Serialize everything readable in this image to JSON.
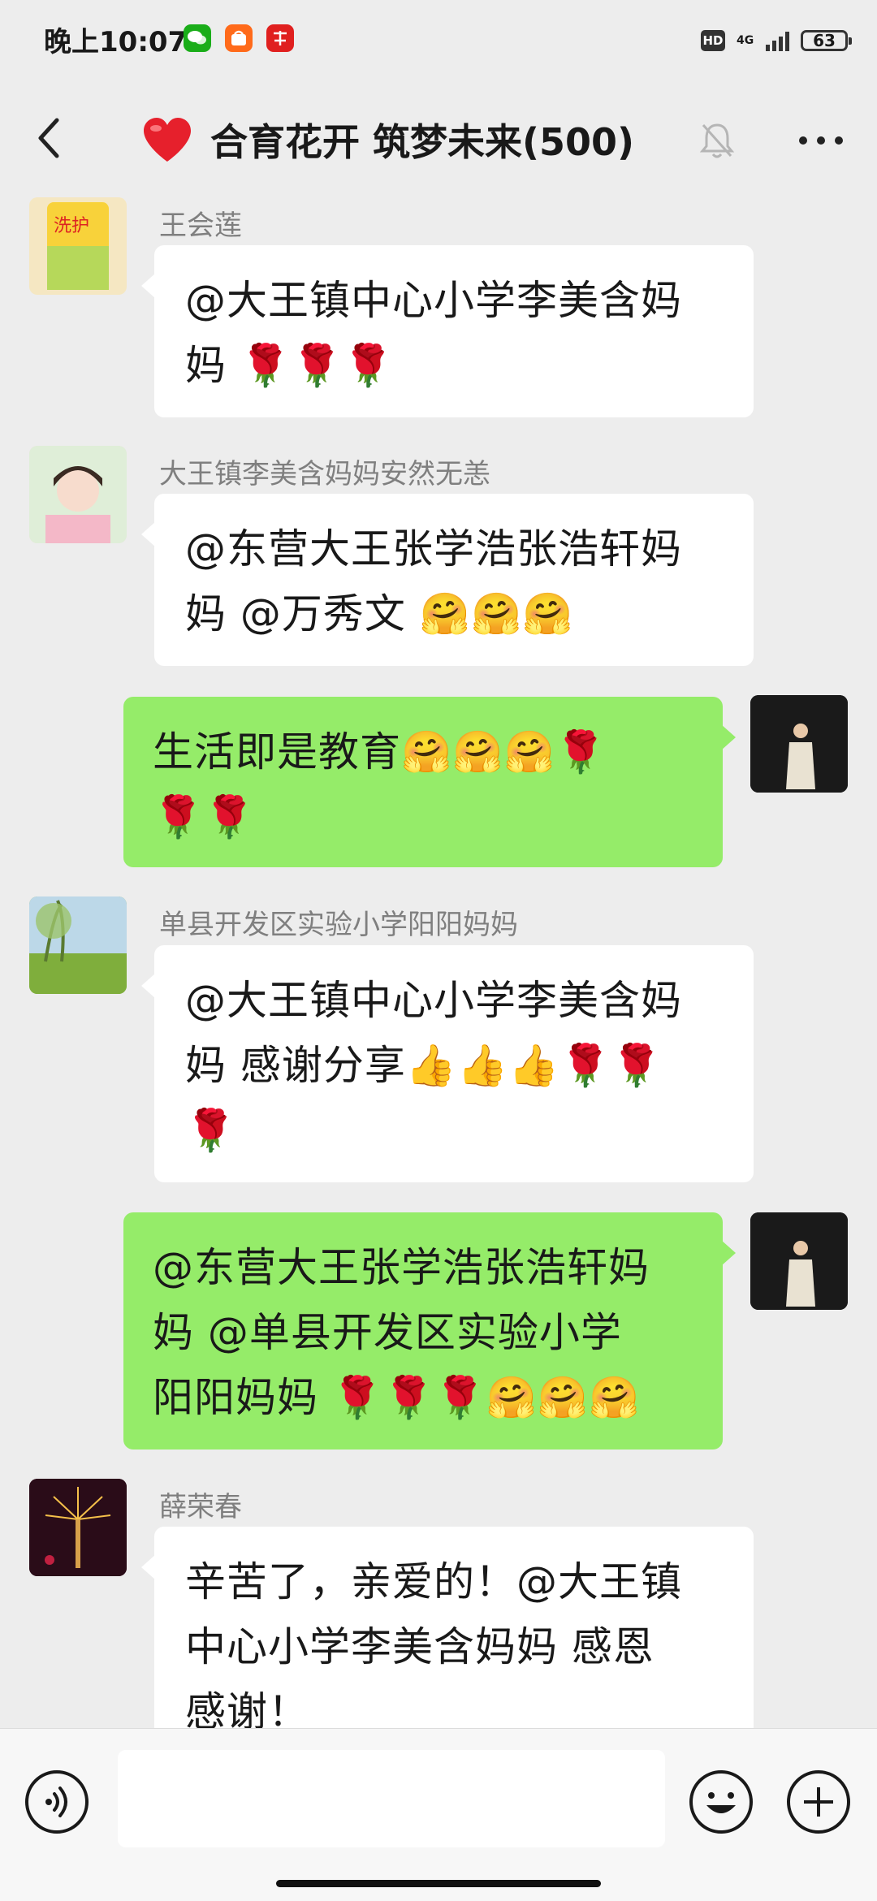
{
  "status_bar": {
    "time": "晚上10:07",
    "hd": "HD",
    "network": "4G",
    "battery": "63",
    "app_icons": [
      "wechat-icon",
      "taobao-icon",
      "xuexi-icon"
    ]
  },
  "chat_header": {
    "title": "合育花开 筑梦未来(500)",
    "icons": [
      "back-icon",
      "heart-icon",
      "mute-bell-icon",
      "more-icon"
    ]
  },
  "messages": [
    {
      "sender": "王会莲",
      "side": "left",
      "lines": [
        "@大王镇中心小学李美含妈",
        "妈 🌹🌹🌹"
      ]
    },
    {
      "sender": "大王镇李美含妈妈安然无恙",
      "side": "left",
      "lines": [
        "@东营大王张学浩张浩轩妈",
        "妈 @万秀文 🤗🤗🤗"
      ]
    },
    {
      "sender": "",
      "side": "right",
      "lines": [
        "生活即是教育🤗🤗🤗🌹",
        "🌹🌹"
      ]
    },
    {
      "sender": "单县开发区实验小学阳阳妈妈",
      "side": "left",
      "lines": [
        "@大王镇中心小学李美含妈",
        "妈 感谢分享👍👍👍🌹🌹",
        "🌹"
      ]
    },
    {
      "sender": "",
      "side": "right",
      "lines": [
        "@东营大王张学浩张浩轩妈",
        "妈 @单县开发区实验小学",
        "阳阳妈妈 🌹🌹🌹🤗🤗🤗"
      ]
    },
    {
      "sender": "薛荣春",
      "side": "left",
      "lines": [
        "辛苦了，亲爱的！@大王镇",
        "中心小学李美含妈妈 感恩",
        "感谢！"
      ]
    }
  ],
  "input_bar": {
    "icons": [
      "voice-icon",
      "emoji-icon",
      "plus-icon"
    ],
    "value": ""
  },
  "colors": {
    "background": "#ededed",
    "my_bubble": "#95ec69",
    "other_bubble": "#ffffff"
  }
}
